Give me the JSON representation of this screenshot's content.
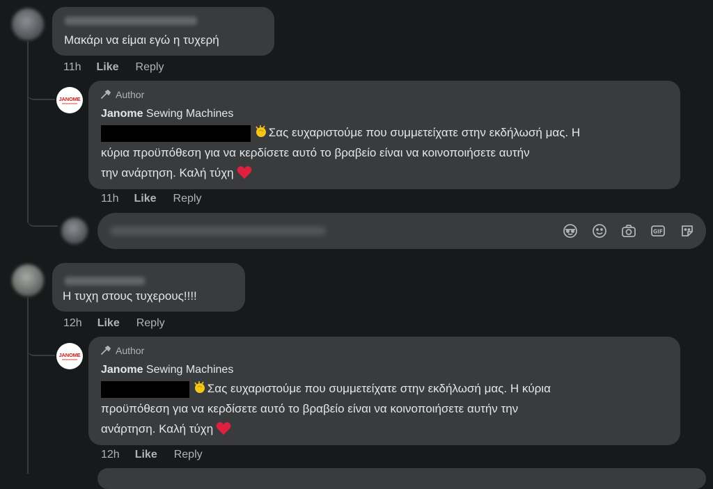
{
  "thread": [
    {
      "comment": {
        "text": "Μακάρι να είμαι εγώ η τυχερή",
        "time": "11h",
        "like": "Like",
        "reply": "Reply"
      },
      "reply": {
        "badge": "Author",
        "page_name_bold": "Janome",
        "page_name_rest": " Sewing Machines",
        "line1": "Σας ευχαριστούμε που συμμετείχατε στην εκδήλωσή μας. Η",
        "line2": "κύρια προϋπόθεση για να κερδίσετε αυτό το βραβείο είναι να κοινοποιήσετε αυτήν",
        "line3": "την ανάρτηση. Καλή τύχη",
        "time": "11h",
        "like": "Like",
        "reply": "Reply"
      }
    },
    {
      "comment": {
        "text": "Η τυχη στους τυχερους!!!!",
        "time": "12h",
        "like": "Like",
        "reply": "Reply"
      },
      "reply": {
        "badge": "Author",
        "page_name_bold": "Janome",
        "page_name_rest": " Sewing Machines",
        "line1": "Σας ευχαριστούμε που συμμετείχατε στην εκδήλωσή μας. Η κύρια",
        "line2": "προϋπόθεση για να κερδίσετε αυτό το βραβείο είναι να κοινοποιήσετε αυτήν την",
        "line3": "ανάρτηση. Καλή τύχη",
        "time": "12h",
        "like": "Like",
        "reply": "Reply"
      }
    }
  ],
  "logo": {
    "text": "JANOME"
  },
  "composer": {
    "icons": [
      "avatar-sticker-icon",
      "emoji-icon",
      "camera-icon",
      "gif-icon",
      "sticker-icon"
    ]
  },
  "colors": {
    "background": "#18191a",
    "bubble": "#3a3b3c",
    "heart": "#e02040",
    "clap": "#f5c518"
  }
}
